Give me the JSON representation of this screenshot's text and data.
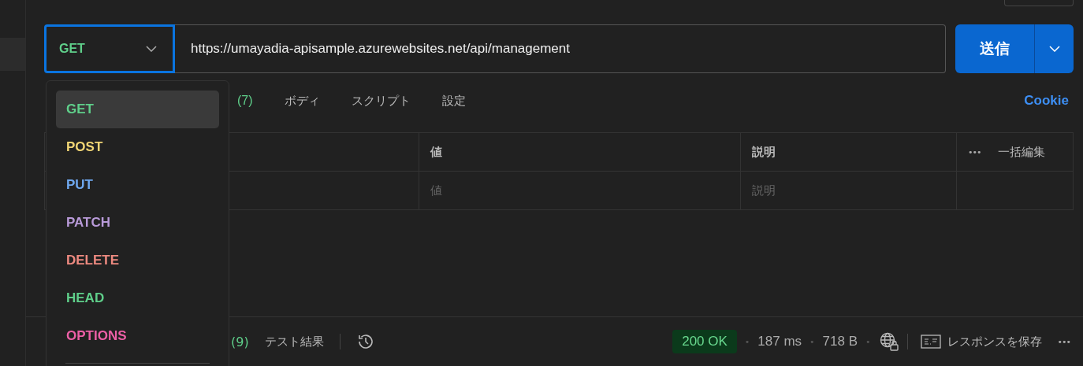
{
  "request": {
    "method": "GET",
    "url": "https://umayadia-apisample.azurewebsites.net/api/management",
    "send_label": "送信"
  },
  "method_menu": {
    "items": [
      {
        "label": "GET",
        "color": "#5fcf8a",
        "selected": true
      },
      {
        "label": "POST",
        "color": "#f2d675",
        "selected": false
      },
      {
        "label": "PUT",
        "color": "#6fa8ef",
        "selected": false
      },
      {
        "label": "PATCH",
        "color": "#b89ad8",
        "selected": false
      },
      {
        "label": "DELETE",
        "color": "#ee8a80",
        "selected": false
      },
      {
        "label": "HEAD",
        "color": "#5fcf8a",
        "selected": false
      },
      {
        "label": "OPTIONS",
        "color": "#ec5fa6",
        "selected": false
      }
    ]
  },
  "tabs": [
    {
      "count": "(7)"
    },
    {
      "label": "ボディ"
    },
    {
      "label": "スクリプト"
    },
    {
      "label": "設定"
    }
  ],
  "cookie_link": "Cookie",
  "table": {
    "columns": [
      "値",
      "説明"
    ],
    "more": "•••",
    "bulk_edit": "一括編集",
    "placeholders": [
      "値",
      "説明"
    ]
  },
  "response_bar": {
    "count": "(9)",
    "test_results": "テスト結果",
    "status": "200 OK",
    "time": "187 ms",
    "size": "718 B",
    "save": "レスポンスを保存",
    "more": "•••",
    "separator": "•"
  }
}
